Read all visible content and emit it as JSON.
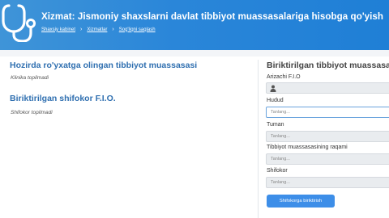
{
  "header": {
    "title": "Xizmat: Jismoniy shaxslarni davlat tibbiyot muassasalariga hisobga qo'yish",
    "icon": "stethoscope-icon",
    "breadcrumbs": [
      {
        "label": "Shaxsiy kabinet"
      },
      {
        "label": "Xizmatlar"
      },
      {
        "label": "Sog'liqni saqlash"
      }
    ]
  },
  "left": {
    "institution_heading": "Hozirda ro'yxatga olingan tibbiyot muassasasi",
    "institution_empty": "Klinika topilmadi",
    "doctor_heading": "Biriktirilgan shifokor F.I.O.",
    "doctor_empty": "Shifokor topilmadi"
  },
  "form": {
    "heading": "Biriktirilgan tibbiyot muassasa",
    "applicant_label": "Arizachi F.I.O",
    "applicant_icon": "user-icon",
    "region_label": "Hudud",
    "region_placeholder": "Tanlang...",
    "district_label": "Tuman",
    "district_placeholder": "Tanlang...",
    "institution_number_label": "Tibbiyot muassasasining raqami",
    "institution_number_placeholder": "Tanlang...",
    "doctor_label": "Shifokor",
    "doctor_placeholder": "Tanlang...",
    "submit_label": "Shifokorga biriktirish"
  },
  "colors": {
    "header_bg": "#2a86d9",
    "heading_blue": "#2f6fb0",
    "button_bg": "#3d8ee8"
  }
}
